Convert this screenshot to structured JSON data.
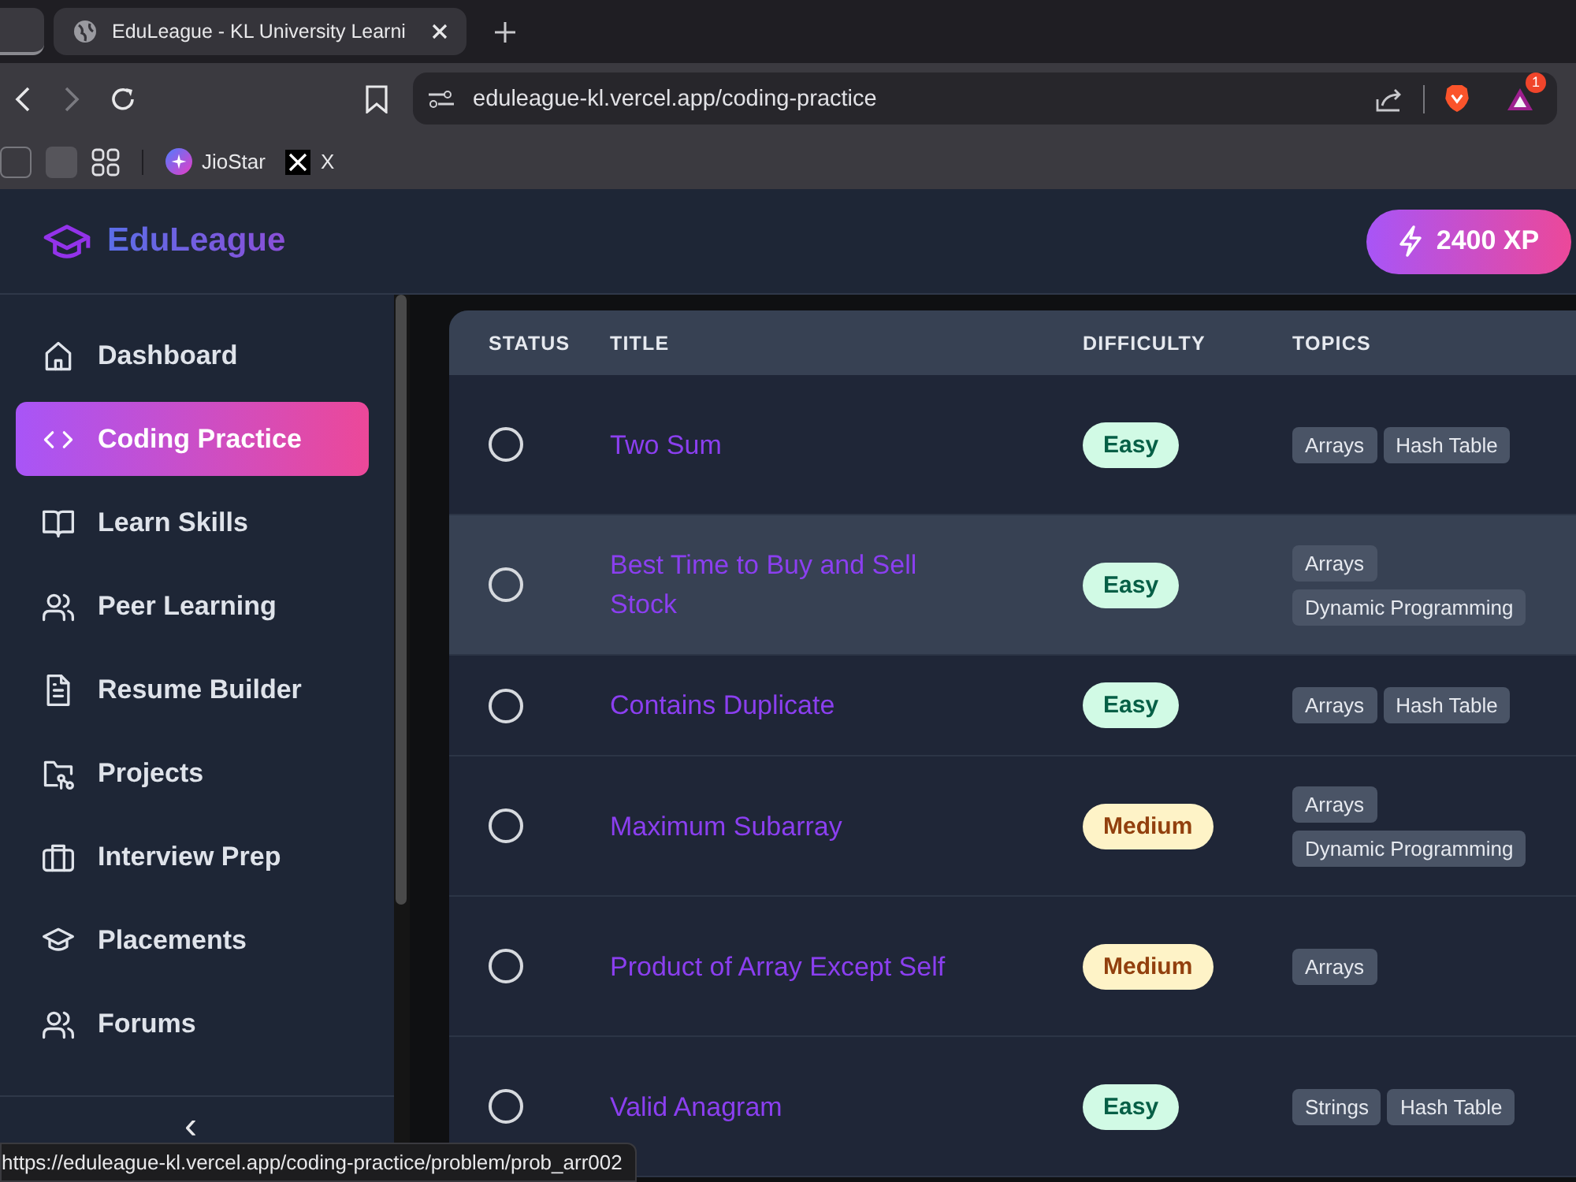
{
  "browser": {
    "tab_title": "EduLeague - KL University Learni",
    "url": "eduleague-kl.vercel.app/coding-practice",
    "notification_count": "1",
    "bookmarks": [
      {
        "label": "JioStar",
        "kind": "star"
      },
      {
        "label": "X",
        "kind": "x"
      }
    ]
  },
  "header": {
    "logo": "EduLeague",
    "xp": "2400 XP"
  },
  "sidebar": {
    "items": [
      {
        "label": "Dashboard",
        "kind": "home",
        "selected": false
      },
      {
        "label": "Coding Practice",
        "kind": "code",
        "selected": true
      },
      {
        "label": "Learn Skills",
        "kind": "book",
        "selected": false
      },
      {
        "label": "Peer Learning",
        "kind": "users",
        "selected": false
      },
      {
        "label": "Resume Builder",
        "kind": "file",
        "selected": false
      },
      {
        "label": "Projects",
        "kind": "folder",
        "selected": false
      },
      {
        "label": "Interview Prep",
        "kind": "briefcase",
        "selected": false
      },
      {
        "label": "Placements",
        "kind": "cap",
        "selected": false
      },
      {
        "label": "Forums",
        "kind": "users",
        "selected": false
      }
    ],
    "collapse": "‹"
  },
  "table": {
    "columns": [
      "STATUS",
      "TITLE",
      "DIFFICULTY",
      "TOPICS"
    ],
    "rows": [
      {
        "solved": false,
        "highlighted": false,
        "title": "Two Sum",
        "difficulty": {
          "label": "Easy",
          "kind": "easy"
        },
        "topics": [
          "Arrays",
          "Hash Table"
        ]
      },
      {
        "solved": false,
        "highlighted": true,
        "title": "Best Time to Buy and Sell Stock",
        "difficulty": {
          "label": "Easy",
          "kind": "easy"
        },
        "topics": [
          "Arrays",
          "Dynamic Programming"
        ]
      },
      {
        "solved": false,
        "highlighted": false,
        "title": "Contains Duplicate",
        "difficulty": {
          "label": "Easy",
          "kind": "easy"
        },
        "topics": [
          "Arrays",
          "Hash Table"
        ]
      },
      {
        "solved": false,
        "highlighted": false,
        "title": "Maximum Subarray",
        "difficulty": {
          "label": "Medium",
          "kind": "medium"
        },
        "topics": [
          "Arrays",
          "Dynamic Programming"
        ]
      },
      {
        "solved": false,
        "highlighted": false,
        "title": "Product of Array Except Self",
        "difficulty": {
          "label": "Medium",
          "kind": "medium"
        },
        "topics": [
          "Arrays"
        ]
      },
      {
        "solved": false,
        "highlighted": false,
        "title": "Valid Anagram",
        "difficulty": {
          "label": "Easy",
          "kind": "easy"
        },
        "topics": [
          "Strings",
          "Hash Table"
        ]
      }
    ]
  },
  "status_url": "https://eduleague-kl.vercel.app/coding-practice/problem/prob_arr002"
}
